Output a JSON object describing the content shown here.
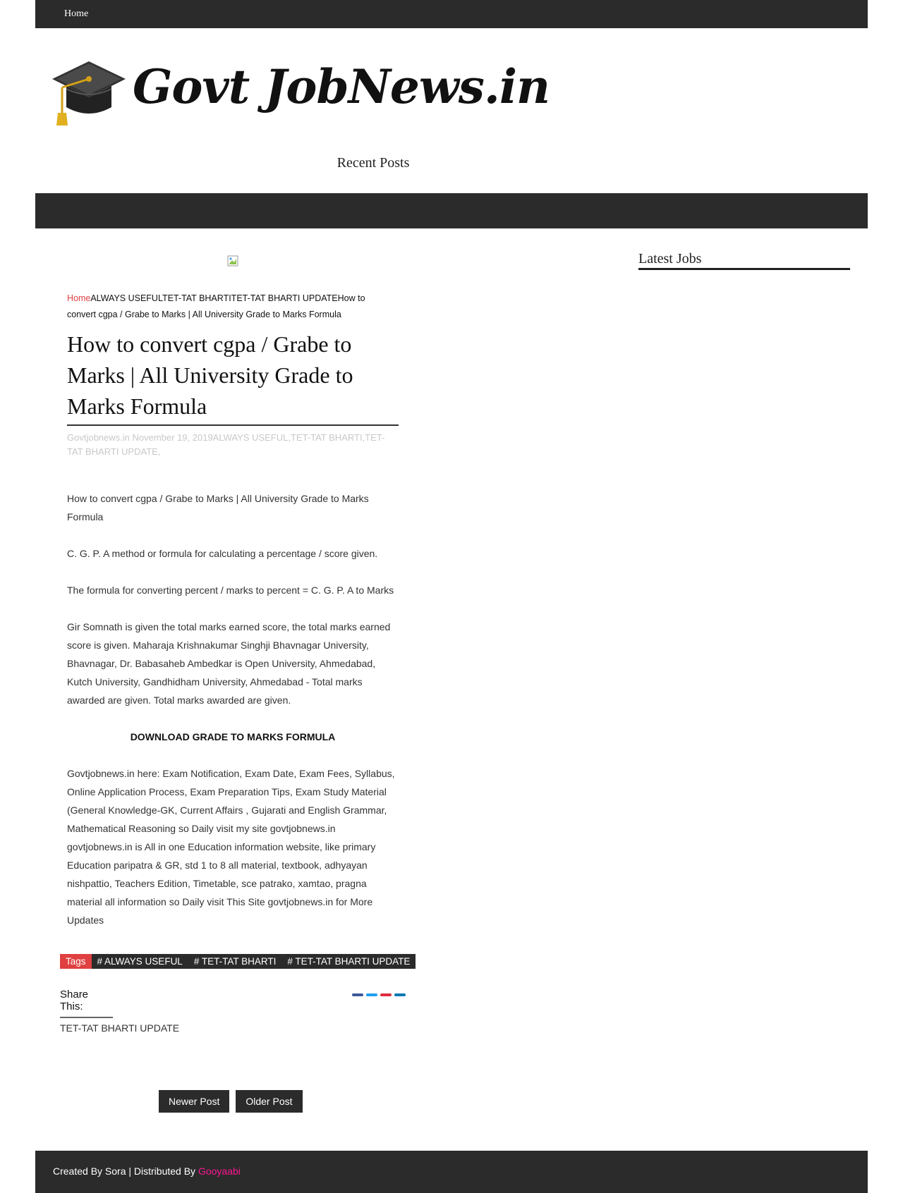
{
  "nav": {
    "home_label": "Home"
  },
  "site": {
    "logo_text": "Govt JobNews.in",
    "recent_posts": "Recent Posts"
  },
  "sidebar": {
    "latest_jobs_title": "Latest Jobs"
  },
  "breadcrumb": {
    "home": "Home",
    "path": "ALWAYS USEFULTET-TAT BHARTITET-TAT BHARTI UPDATEHow to convert cgpa / Grabe to Marks | All University Grade to Marks Formula"
  },
  "post": {
    "title": "How to convert cgpa / Grabe to Marks | All University Grade to Marks Formula",
    "meta": "Govtjobnews.in  November 19, 2019ALWAYS USEFUL,TET-TAT BHARTI,TET-TAT BHARTI UPDATE,",
    "paragraphs": [
      "How to convert cgpa / Grabe to Marks | All University Grade to Marks Formula",
      "C.  G.  P.  A method or formula for calculating a percentage / score given.",
      " The formula for converting percent / marks to percent = C. G.  P.  A to Marks",
      " Gir Somnath is given the total marks earned score, the total marks earned score is given.  Maharaja Krishnakumar Singhji Bhavnagar University, Bhavnagar, Dr.  Babasaheb Ambedkar is Open University, Ahmedabad, Kutch University, Gandhidham University, Ahmedabad - Total marks awarded are given.  Total marks awarded are given."
    ],
    "download_label": "DOWNLOAD GRADE TO MARKS FORMULA",
    "about": "Govtjobnews.in here: Exam Notification, Exam Date, Exam Fees, Syllabus, Online Application Process, Exam Preparation Tips, Exam Study Material (General Knowledge-GK, Current Affairs , Gujarati and English Grammar, Mathematical Reasoning so Daily visit my site govtjobnews.in govtjobnews.in is All in one Education information website, like primary Education paripatra & GR, std 1 to 8 all material, textbook, adhyayan nishpattio, Teachers Edition, Timetable, sce patrako, xamtao, pragna material all information so Daily visit This Site govtjobnews.in for More Updates"
  },
  "tags": {
    "label": "Tags",
    "items": [
      "# ALWAYS USEFUL",
      "# TET-TAT BHARTI",
      "# TET-TAT BHARTI UPDATE"
    ]
  },
  "share": {
    "label": "Share This:",
    "colors": [
      "#3b5998",
      "#1da1f2",
      "#dd2c3f",
      "#0077b5"
    ],
    "icons": [
      "facebook-share-icon",
      "twitter-share-icon",
      "pinterest-share-icon",
      "linkedin-share-icon"
    ]
  },
  "related_label": "TET-TAT BHARTI UPDATE",
  "pager": {
    "newer": "Newer Post",
    "older": "Older Post"
  },
  "footer": {
    "prefix": "Created By Sora | Distributed By ",
    "brand": "Gooyaabi"
  }
}
